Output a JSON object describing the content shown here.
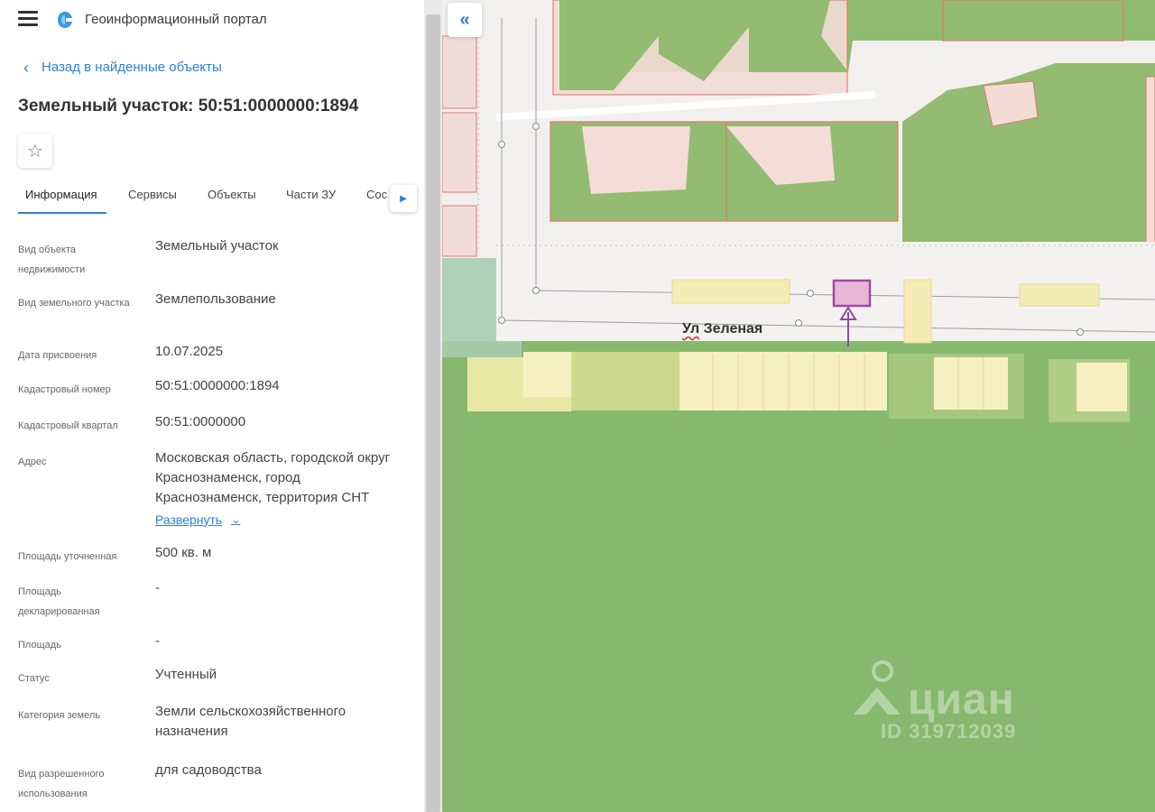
{
  "header": {
    "portal_title": "Геоинформационный портал",
    "menu_icon": "hamburger-menu-icon",
    "logo_icon": "portal-logo-icon"
  },
  "navigation": {
    "back_label": "Назад в найденные объекты"
  },
  "object": {
    "title": "Земельный участок: 50:51:0000000:1894"
  },
  "tabs": [
    {
      "label": "Информация",
      "active": true
    },
    {
      "label": "Сервисы",
      "active": false
    },
    {
      "label": "Объекты",
      "active": false
    },
    {
      "label": "Части ЗУ",
      "active": false
    },
    {
      "label": "Сос",
      "active": false
    }
  ],
  "info": {
    "rows": [
      {
        "label": "Вид объекта недвижимости",
        "value": "Земельный участок"
      },
      {
        "label": "Вид земельного участка",
        "value": "Землепользование"
      },
      {
        "label": "Дата присвоения",
        "value": "10.07.2025"
      },
      {
        "label": "Кадастровый номер",
        "value": "50:51:0000000:1894"
      },
      {
        "label": "Кадастровый квартал",
        "value": "50:51:0000000"
      },
      {
        "label": "Адрес",
        "value": "Московская область, городской округ Краснознаменск, город Краснознаменск, территория СНТ"
      },
      {
        "label": "Площадь уточненная",
        "value": "500 кв. м"
      },
      {
        "label": "Площадь декларированная",
        "value": "-"
      },
      {
        "label": "Площадь",
        "value": "-"
      },
      {
        "label": "Статус",
        "value": "Учтенный"
      },
      {
        "label": "Категория земель",
        "value": "Земли сельскохозяйственного назначения"
      },
      {
        "label": "Вид разрешенного использования",
        "value": "для садоводства"
      }
    ],
    "expand_label": "Развернуть"
  },
  "map": {
    "street_prefix": "Ул",
    "street_name": "Зеленая",
    "collapse_icon": "double-chevron-left-icon",
    "colors": {
      "green_zone": "#86b96e",
      "parcel_outline": "#e0786a",
      "highlight_parcel": "#a04ba0",
      "yellow_parcel": "#f3ecb4"
    }
  },
  "watermark": {
    "brand": "циан",
    "listing_id": "ID 319712039"
  }
}
